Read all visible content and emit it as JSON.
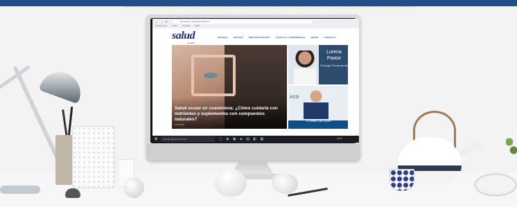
{
  "browser": {
    "nav_glyphs": "← → ⟳",
    "url": "Not secure | saludeninsular.com",
    "bookmarks": [
      "Aplicaciones",
      "Gmail",
      "YouTube",
      "Maps"
    ]
  },
  "site": {
    "logo": "salud",
    "logo_sub": "en casa",
    "nav": [
      "PORTADA",
      "NOTICIAS",
      "MEDICINA INTEGRAL",
      "CHARLAS Y CONFERENCIAS",
      "VIDEOS",
      "CONTACTO"
    ]
  },
  "hero": {
    "title": "Salud ocular en cuarentena: ¿Cómo cuidarla con nutrientes y suplementos con compuestos naturales?",
    "meta": "Lucía Mari"
  },
  "card_a": {
    "name": "Lorena Pastor",
    "role": "Psicóloga Psicoterapeuta"
  },
  "card_b": {
    "logo": "ACO",
    "name": "Dr. Alberto Calvo Quiroz"
  },
  "taskbar": {
    "start_icon": "windows-icon",
    "search_placeholder": "Escribe aquí para buscar",
    "icons": "▢ ◉ ▣ ◈ ▤ ◧ ▦",
    "clock": "16:35"
  },
  "imac": {
    "logo_glyph": ""
  },
  "colors": {
    "top_band": "#1f4f86",
    "logo_blue": "#1e2f78",
    "nav_blue": "#2a6b9c",
    "card_panel": "#2d4b6e"
  }
}
